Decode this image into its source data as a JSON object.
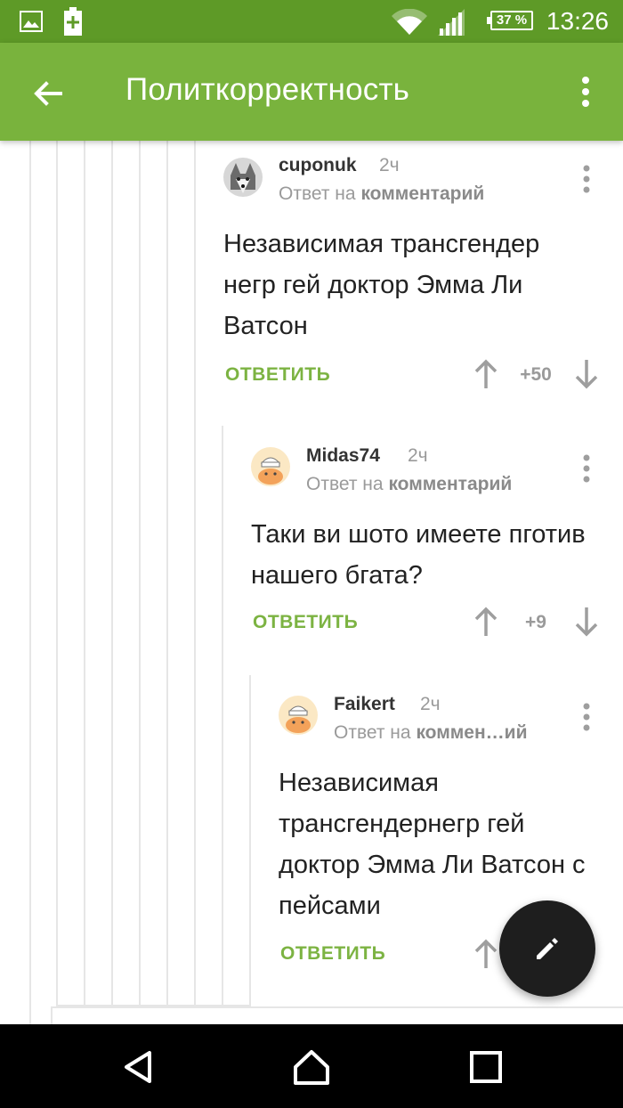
{
  "status_bar": {
    "time": "13:26",
    "battery": "37 %",
    "icons": [
      "image-icon",
      "battery-saver-icon",
      "wifi-icon",
      "signal-icon",
      "battery-icon"
    ]
  },
  "app_bar": {
    "title": "Политкорректность",
    "back_icon": "arrow-back-icon",
    "more_icon": "more-vert-icon"
  },
  "comments": [
    {
      "author": "cuponuk",
      "time": "2ч",
      "reply_prefix": "Ответ на",
      "reply_target": "комментарий",
      "body": "Независимая трансгендер негр гей доктор Эмма Ли Ватсон",
      "reply_label": "ОТВЕТИТЬ",
      "rating": "+50"
    },
    {
      "author": "Midas74",
      "time": "2ч",
      "reply_prefix": "Ответ на",
      "reply_target": "комментарий",
      "body": "Таки ви шото имеете пготив нашего бгата?",
      "reply_label": "ОТВЕТИТЬ",
      "rating": "+9"
    },
    {
      "author": "Faikert",
      "time": "2ч",
      "reply_prefix": "Ответ на",
      "reply_target": "коммен…ий",
      "body": "Независимая трансгендернегр гей доктор Эмма Ли Ватсон с пейсами",
      "reply_label": "ОТВЕТИТЬ",
      "rating": ""
    }
  ],
  "fab_icon": "pencil-icon",
  "nav_bar": {
    "icons": [
      "back-triangle-icon",
      "home-icon",
      "recents-icon"
    ]
  },
  "colors": {
    "status_bar": "#5e9a27",
    "app_bar": "#79b33d",
    "accent": "#7cb342",
    "fab": "#1e1e1e"
  }
}
